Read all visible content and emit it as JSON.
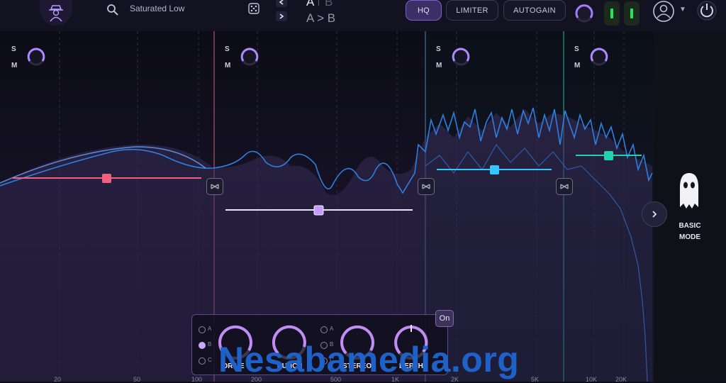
{
  "toolbar": {
    "preset_name": "Saturated Low",
    "ab_a": "A",
    "ab_b": "B",
    "ab_copy": "A > B",
    "buttons": {
      "hq": "HQ",
      "limiter": "LIMITER",
      "autogain": "AUTOGAIN"
    },
    "hq_active": true
  },
  "icons": {
    "logo": "spy-agent-icon",
    "search": "search-icon",
    "random": "dice-icon",
    "user": "user-icon",
    "power": "power-icon",
    "mode": "ghost-icon"
  },
  "bands": [
    {
      "solo": "S",
      "mute": "M",
      "color": "#f2607f"
    },
    {
      "solo": "S",
      "mute": "M",
      "color": "#c79cff"
    },
    {
      "solo": "S",
      "mute": "M",
      "color": "#35c6ff"
    },
    {
      "solo": "S",
      "mute": "M",
      "color": "#22d3b0"
    }
  ],
  "basic_mode": {
    "label": "BASIC\nMODE"
  },
  "saturation": {
    "on_label": "On",
    "modes": [
      "A",
      "B",
      "C"
    ],
    "selected_mode": "B",
    "modes_2": [
      "A",
      "B",
      "C"
    ],
    "knob_labels": [
      "DRIVE",
      "PUNCH",
      "STEREO",
      "DEPTH"
    ]
  },
  "freq_ticks": [
    "20",
    "50",
    "100",
    "200",
    "500",
    "1K",
    "2K",
    "5K",
    "10K",
    "20K"
  ],
  "watermark": "Nesabamedia.org",
  "colors": {
    "accent": "#7a62d6",
    "meter": "#22e65a",
    "background": "#0d0d17"
  }
}
